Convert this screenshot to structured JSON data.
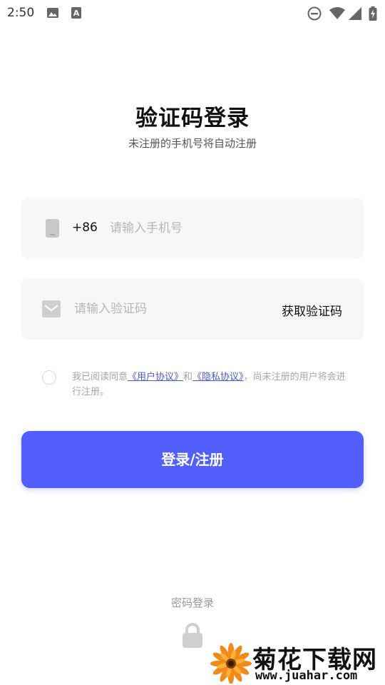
{
  "status_bar": {
    "time": "2:50",
    "icons": [
      "image-icon",
      "text-a-icon",
      "do-not-disturb-icon",
      "wifi-icon",
      "signal-icon",
      "battery-charging-icon"
    ]
  },
  "header": {
    "title": "验证码登录",
    "subtitle": "未注册的手机号将自动注册"
  },
  "phone_field": {
    "country_code": "+86",
    "placeholder": "请输入手机号",
    "value": ""
  },
  "code_field": {
    "placeholder": "请输入验证码",
    "value": "",
    "get_code_label": "获取验证码"
  },
  "agreement": {
    "checked": false,
    "prefix": "我已阅读同意",
    "user_agreement": "《用户协议》",
    "and": "和",
    "privacy_policy": "《隐私协议》",
    "suffix": "，尚未注册的用户将会进行注册。"
  },
  "login_button_label": "登录/注册",
  "password_login_label": "密码登录",
  "watermark": {
    "title": "菊花下载网",
    "url": "www.juahar.com"
  },
  "colors": {
    "primary": "#525efe",
    "field_bg": "#f7f7f7",
    "link": "#4f5bd5",
    "placeholder": "#b7b7b7"
  }
}
